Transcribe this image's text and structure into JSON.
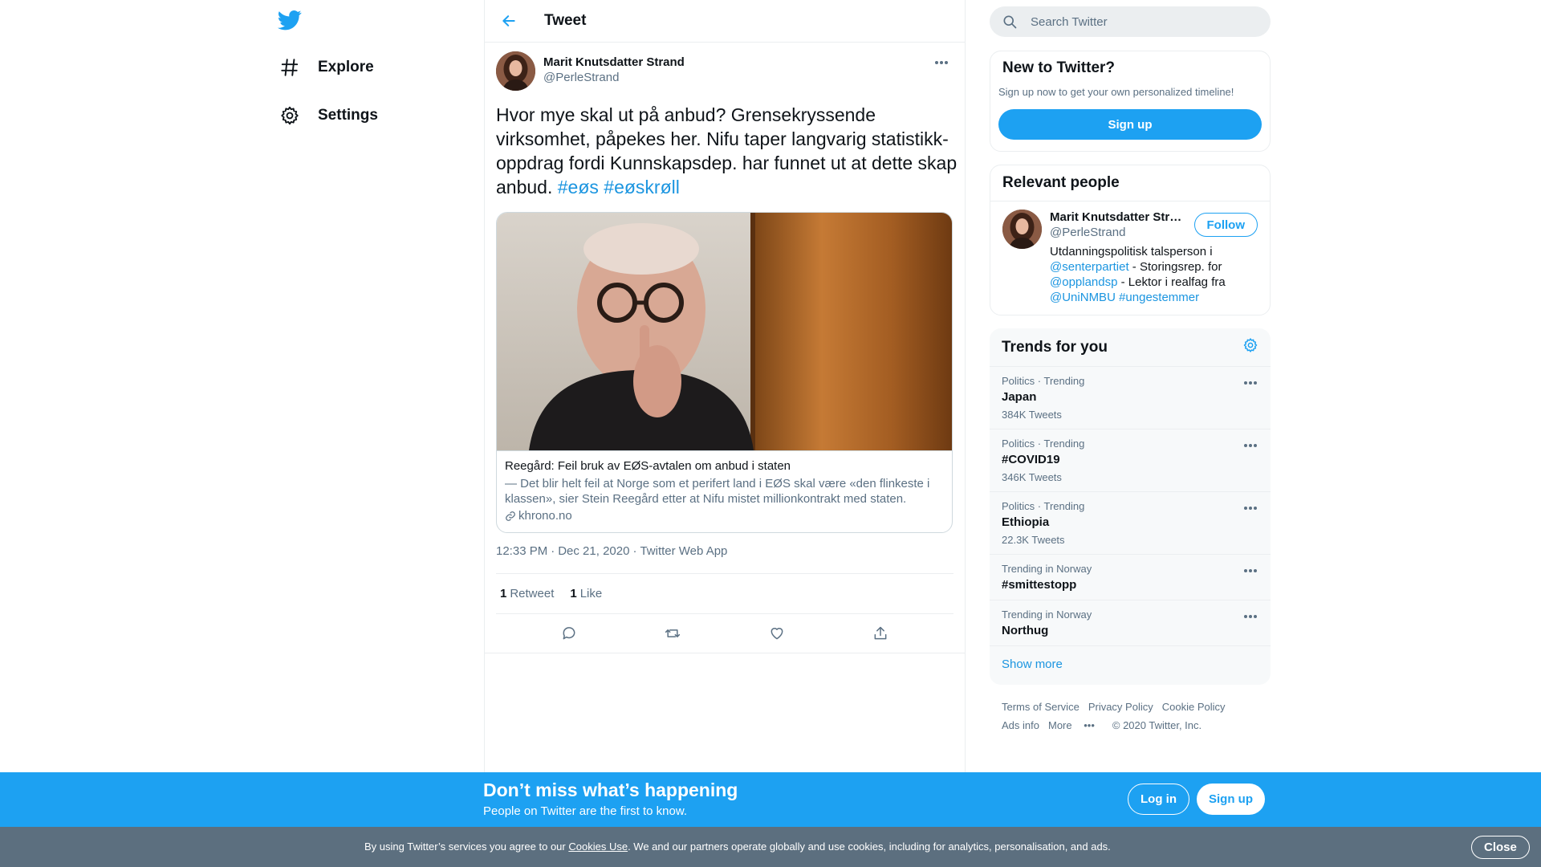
{
  "nav": {
    "logo": "twitter-bird",
    "items": [
      {
        "label": "Explore",
        "icon": "hash-icon"
      },
      {
        "label": "Settings",
        "icon": "gear-icon"
      }
    ]
  },
  "header": {
    "title": "Tweet"
  },
  "tweet": {
    "author_name": "Marit Knutsdatter Strand",
    "author_handle": "@PerleStrand",
    "text": "Hvor mye skal ut på anbud? Grensekryssende virksomhet, påpekes her. Nifu taper langvarig statistikk-oppdrag fordi Kunnskapsdep. har funnet ut at dette skap anbud.",
    "hashtags": [
      "#eøs",
      "#eøskrøll"
    ],
    "card": {
      "title": "Reegård: Feil bruk av EØS-avtalen om anbud i staten",
      "description": "— Det blir helt feil at Norge som et perifert land i EØS skal være «den flinkeste i klassen», sier Stein Reegård etter at Nifu mistet millionkontrakt med staten.",
      "domain": "khrono.no"
    },
    "time": "12:33 PM",
    "date": "Dec 21, 2020",
    "source": "Twitter Web App",
    "retweets": "1",
    "retweets_label": "Retweet",
    "likes": "1",
    "likes_label": "Like"
  },
  "search": {
    "placeholder": "Search Twitter"
  },
  "new_to_twitter": {
    "title": "New to Twitter?",
    "subtitle": "Sign up now to get your own personalized timeline!",
    "button": "Sign up"
  },
  "relevant": {
    "title": "Relevant people",
    "person": {
      "name": "Marit Knutsdatter Strand",
      "handle": "@PerleStrand",
      "follow": "Follow",
      "bio_1": "Utdanningspolitisk talsperson i ",
      "bio_link_1": "@senterpartiet",
      "bio_2": " - Storingsrep. for ",
      "bio_link_2": "@opplandsp",
      "bio_3": " - Lektor i realfag fra ",
      "bio_link_3": "@UniNMBU",
      "bio_link_4": "#ungestemmer"
    }
  },
  "trends": {
    "title": "Trends for you",
    "items": [
      {
        "context": "Politics · Trending",
        "name": "Japan",
        "count": "384K Tweets"
      },
      {
        "context": "Politics · Trending",
        "name": "#COVID19",
        "count": "346K Tweets"
      },
      {
        "context": "Politics · Trending",
        "name": "Ethiopia",
        "count": "22.3K Tweets"
      },
      {
        "context": "Trending in Norway",
        "name": "#smittestopp",
        "count": ""
      },
      {
        "context": "Trending in Norway",
        "name": "Northug",
        "count": ""
      }
    ],
    "show_more": "Show more"
  },
  "footer": {
    "links": [
      "Terms of Service",
      "Privacy Policy",
      "Cookie Policy",
      "Ads info",
      "More"
    ],
    "copyright": "© 2020 Twitter, Inc."
  },
  "promo": {
    "title": "Don’t miss what’s happening",
    "subtitle": "People on Twitter are the first to know.",
    "login": "Log in",
    "signup": "Sign up"
  },
  "cookie": {
    "prefix": "By using Twitter’s services you agree to our ",
    "link": "Cookies Use",
    "suffix": ". We and our partners operate globally and use cookies, including for analytics, personalisation, and ads.",
    "close": "Close"
  },
  "colors": {
    "accent": "#1da1f2",
    "link": "#1b95e0",
    "muted": "#5b7083",
    "cookie_bar": "#5c6f7f"
  }
}
